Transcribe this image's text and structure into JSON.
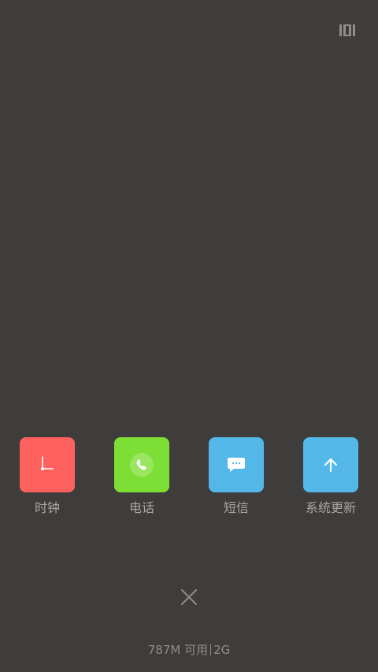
{
  "header": {
    "toggle_icon": "list-view-icon"
  },
  "apps": [
    {
      "label": "时钟",
      "icon": "clock-icon",
      "color": "#fd615d"
    },
    {
      "label": "电话",
      "icon": "phone-icon",
      "color": "#7ddf35"
    },
    {
      "label": "短信",
      "icon": "message-icon",
      "color": "#53b8e8"
    },
    {
      "label": "系统更新",
      "icon": "arrow-up-icon",
      "color": "#53b8e8"
    }
  ],
  "footer": {
    "close_icon": "close-icon",
    "memory_available": "787M 可用",
    "memory_total": "2G"
  },
  "colors": {
    "background": "#3f3d3c",
    "label_text": "#a9a7a5",
    "icon_gray": "#8f8d8b"
  }
}
